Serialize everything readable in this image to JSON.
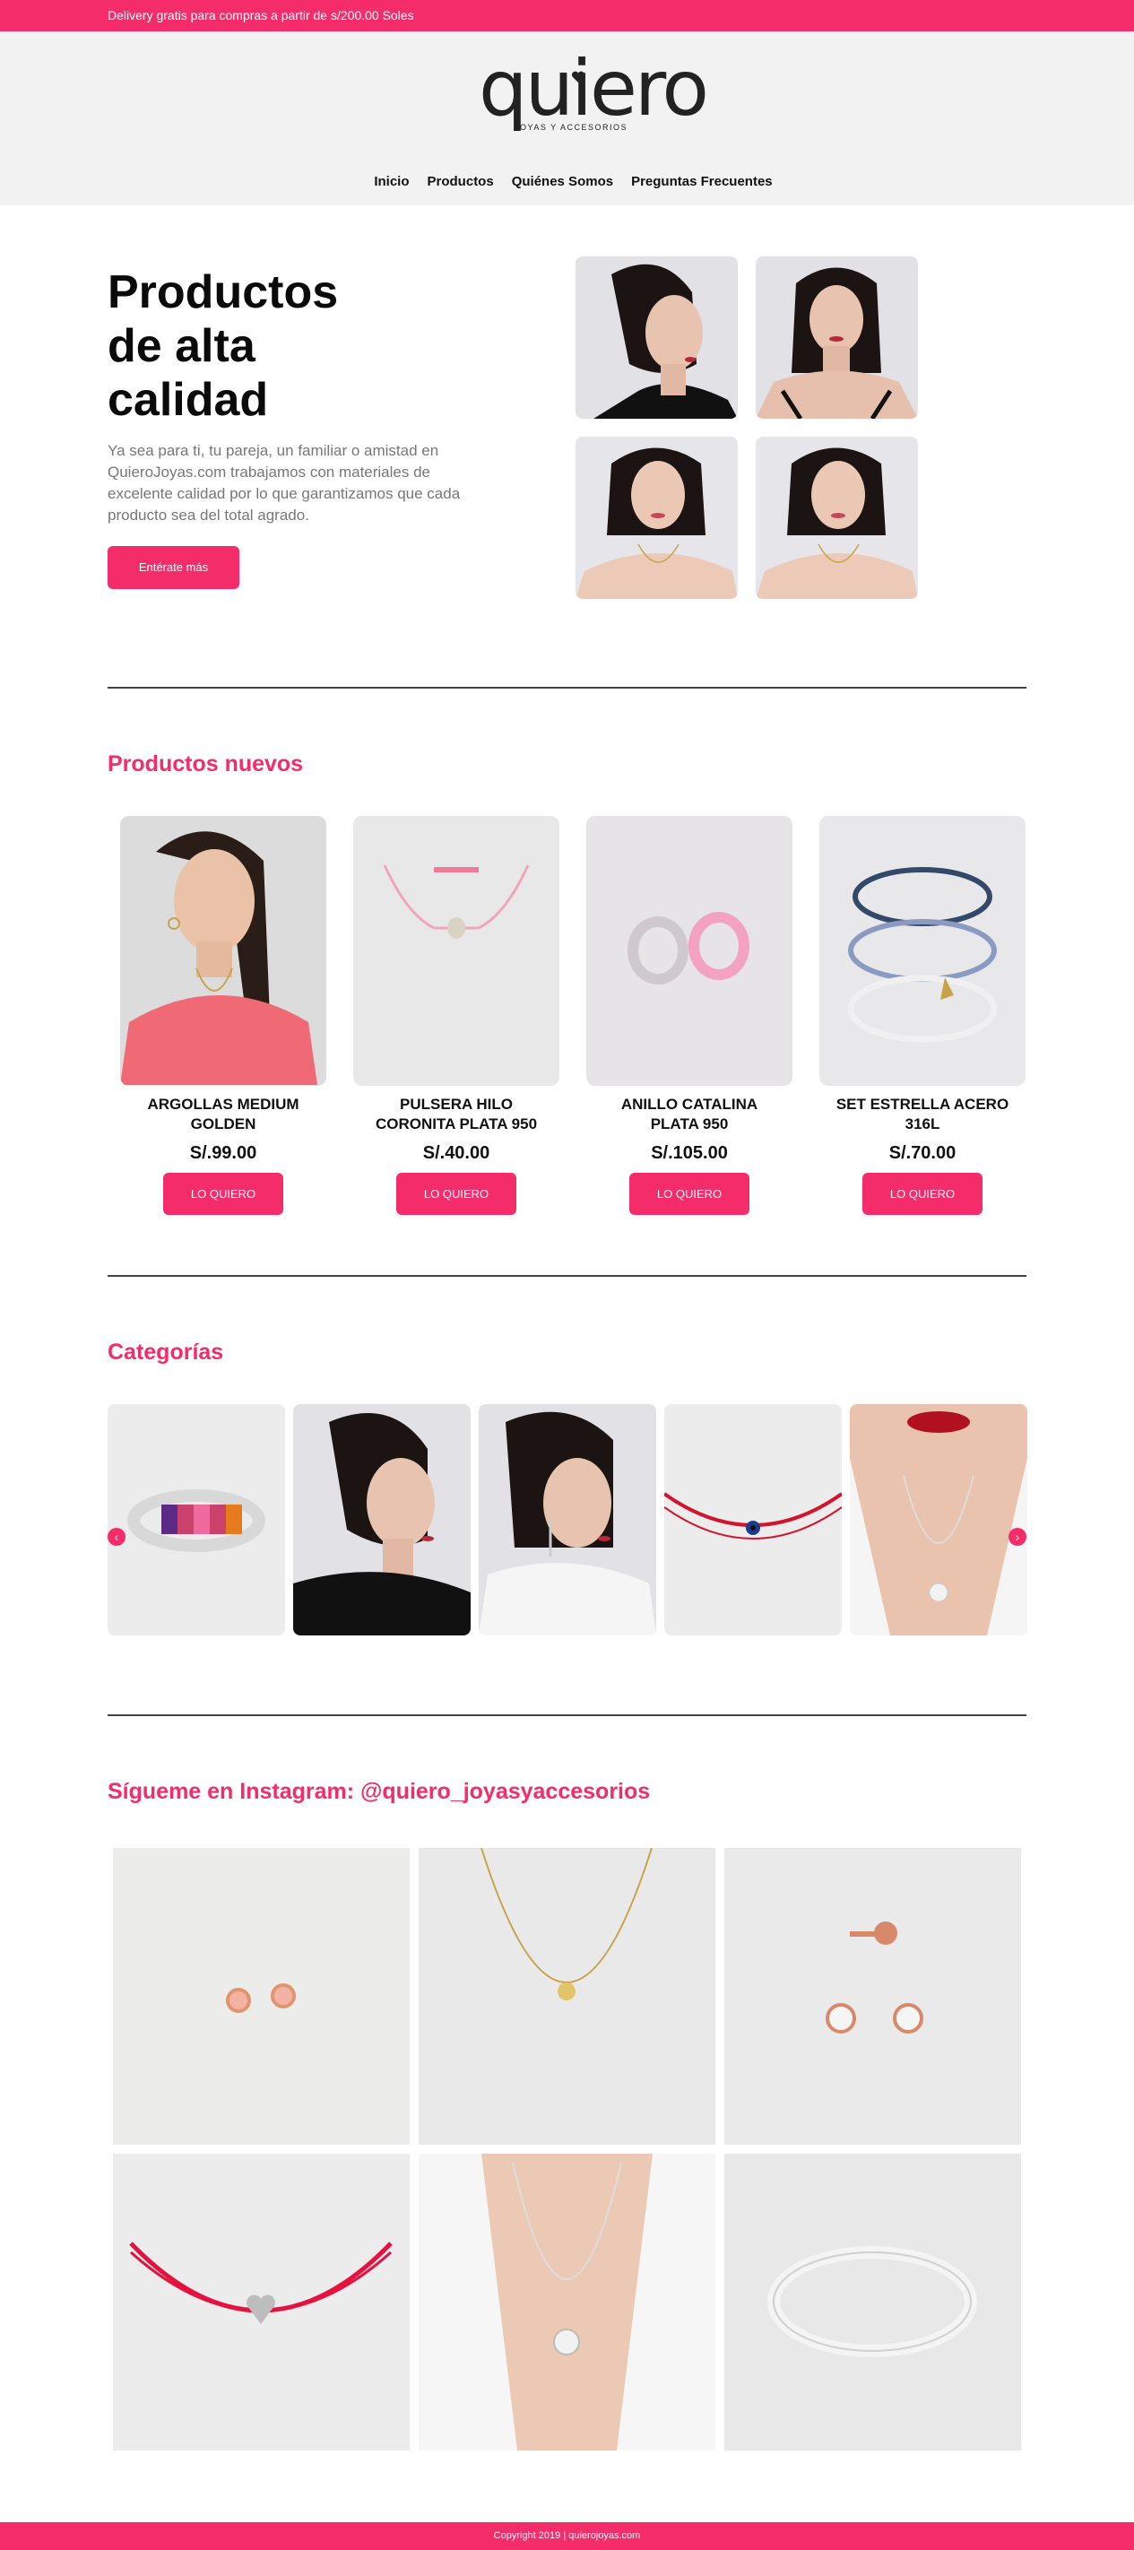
{
  "topbar": {
    "text": "Delivery gratis para compras a partir de s/200.00 Soles"
  },
  "logo": {
    "word": "quiero",
    "subtitle": "JOYAS Y ACCESORIOS"
  },
  "nav": [
    {
      "label": "Inicio"
    },
    {
      "label": "Productos"
    },
    {
      "label": "Quiénes Somos"
    },
    {
      "label": "Preguntas Frecuentes"
    }
  ],
  "hero": {
    "title": "Productos de alta calidad",
    "text": "Ya sea para ti, tu pareja, un familiar o amistad en QuieroJoyas.com trabajamos con materiales de excelente calidad por lo que garantizamos que cada producto sea del total agrado.",
    "button": "Entérate más"
  },
  "new_products": {
    "title": "Productos nuevos",
    "items": [
      {
        "name": "ARGOLLAS MEDIUM GOLDEN",
        "price": "S/.99.00",
        "button": "LO QUIERO"
      },
      {
        "name": "PULSERA HILO CORONITA PLATA 950",
        "price": "S/.40.00",
        "button": "LO QUIERO"
      },
      {
        "name": "ANILLO CATALINA PLATA 950",
        "price": "S/.105.00",
        "button": "LO QUIERO"
      },
      {
        "name": "SET ESTRELLA ACERO 316L",
        "price": "S/.70.00",
        "button": "LO QUIERO"
      }
    ]
  },
  "categories": {
    "title": "Categorías",
    "prev": "‹",
    "next": "›"
  },
  "instagram": {
    "title": "Sígueme en Instagram: @quiero_joyasyaccesorios"
  },
  "footer": {
    "text": "Copyright 2019 | quierojoyas.com"
  },
  "colors": {
    "brand": "#f42c6a",
    "header_bg": "#f2f2f2",
    "text_muted": "#777777"
  }
}
